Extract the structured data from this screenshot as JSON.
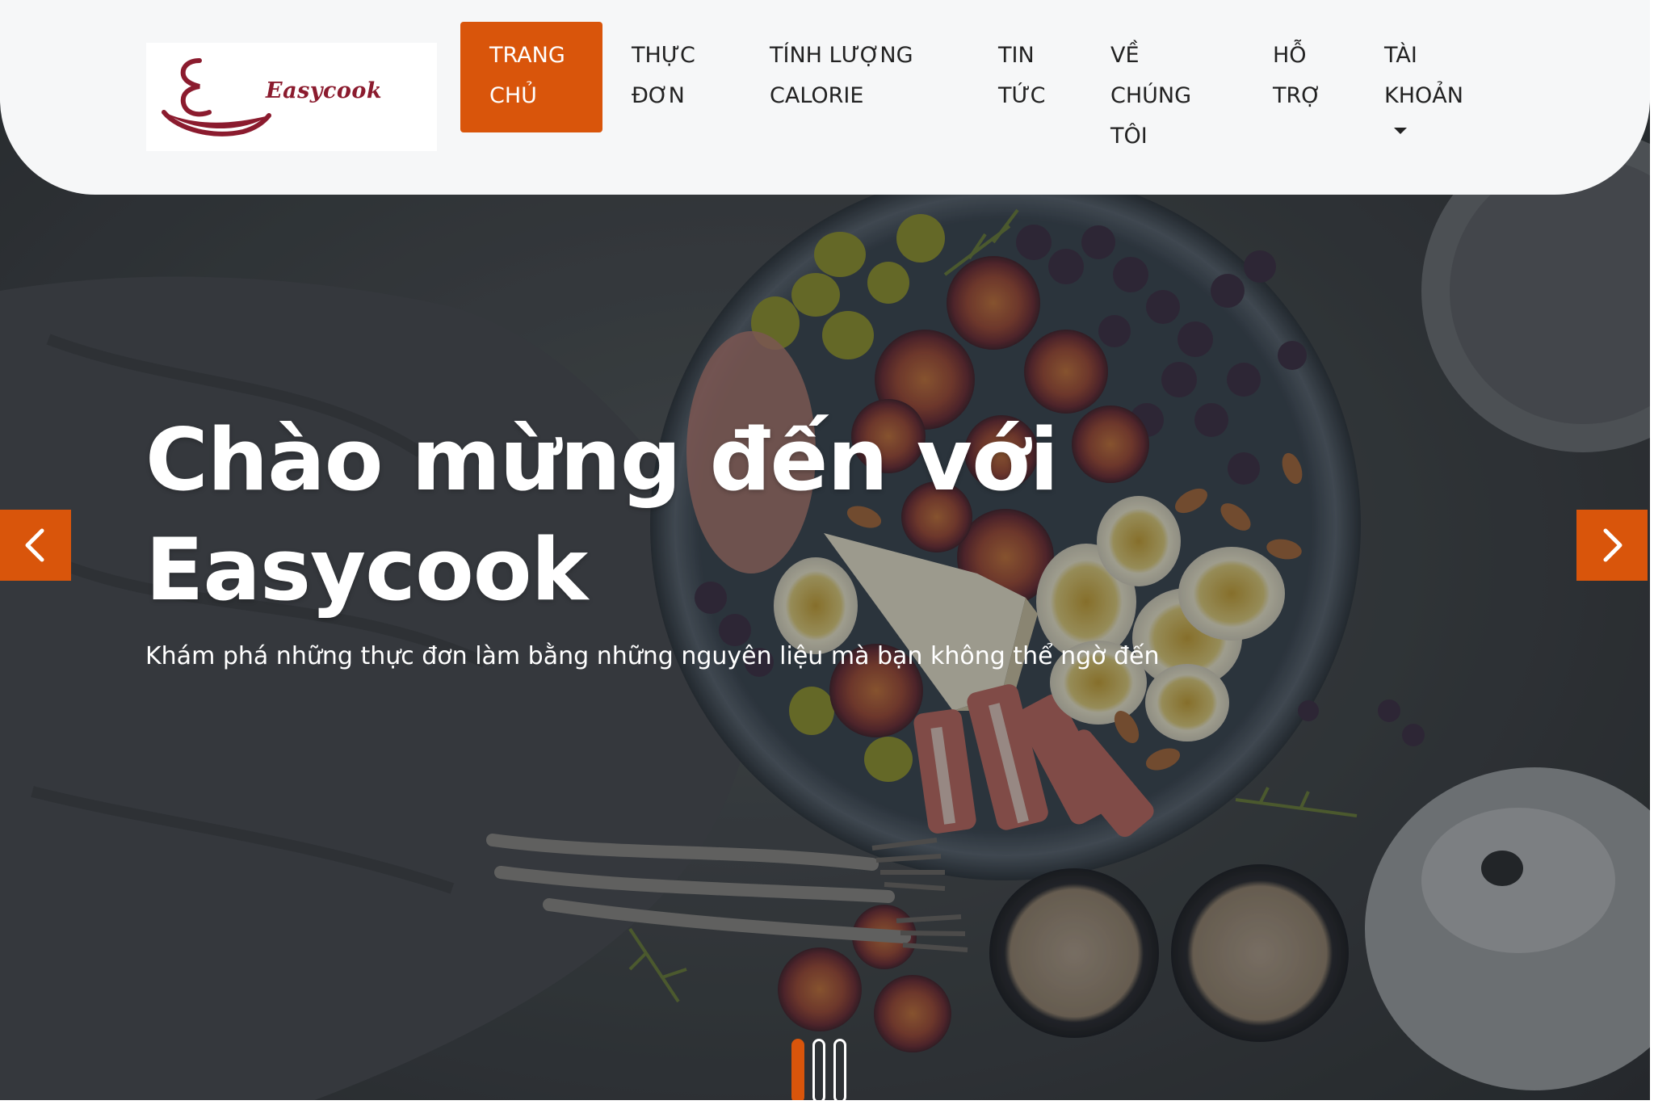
{
  "brand": {
    "name": "Easycook",
    "logo_icon": "easycook-logo-icon",
    "accent_color": "#d9550b",
    "logo_color": "#8b1b2e"
  },
  "nav": {
    "items": [
      {
        "label": "TRANG CHỦ",
        "active": true
      },
      {
        "label": "THỰC ĐƠN",
        "active": false
      },
      {
        "label": "TÍNH LƯỢNG CALORIE",
        "active": false
      },
      {
        "label": "TIN TỨC",
        "active": false
      },
      {
        "label": "VỀ CHÚNG TÔI",
        "active": false
      },
      {
        "label": "HỖ TRỢ",
        "active": false
      },
      {
        "label": "TÀI KHOẢN",
        "active": false,
        "dropdown_icon": "caret-down-icon"
      }
    ]
  },
  "hero": {
    "title_line1": "Chào mừng đến với",
    "title_line2": "Easycook",
    "subtitle": "Khám phá những thực đơn làm bằng những nguyên liệu mà bạn không thể ngờ đến",
    "prev_icon": "chevron-left-icon",
    "next_icon": "chevron-right-icon",
    "slides_total": 3,
    "active_slide": 1
  }
}
